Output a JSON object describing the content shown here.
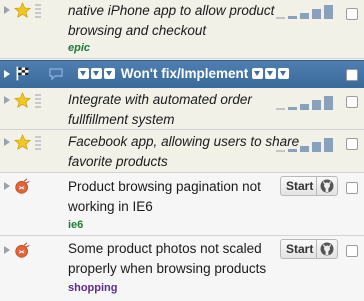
{
  "stories": [
    {
      "id": "s1",
      "title_line1": "native iPhone app to allow product",
      "title_line2": "browsing and checkout",
      "label": "epic",
      "type": "feature"
    },
    {
      "id": "release",
      "title": "Won't fix/Implement"
    },
    {
      "id": "s2",
      "title_line1": "Integrate with automated order",
      "title_line2": "fullfillment system",
      "type": "feature"
    },
    {
      "id": "s3",
      "title_line1": "Facebook app, allowing users to share",
      "title_line2": "favorite products",
      "type": "feature"
    },
    {
      "id": "s4",
      "title_line1": "Product browsing pagination not",
      "title_line2": "working in IE6",
      "label": "ie6",
      "type": "bug",
      "button": "Start"
    },
    {
      "id": "s5",
      "title_line1": "Some product photos not scaled",
      "title_line2": "properly when browsing products",
      "label": "shopping",
      "type": "bug",
      "button": "Start"
    }
  ],
  "colors": {
    "feature_star": "#f3c623",
    "bug": "#e0633a",
    "release_bg": "#3f6f9f",
    "label_green": "#1f7a3a",
    "label_purple": "#5b2c91"
  }
}
